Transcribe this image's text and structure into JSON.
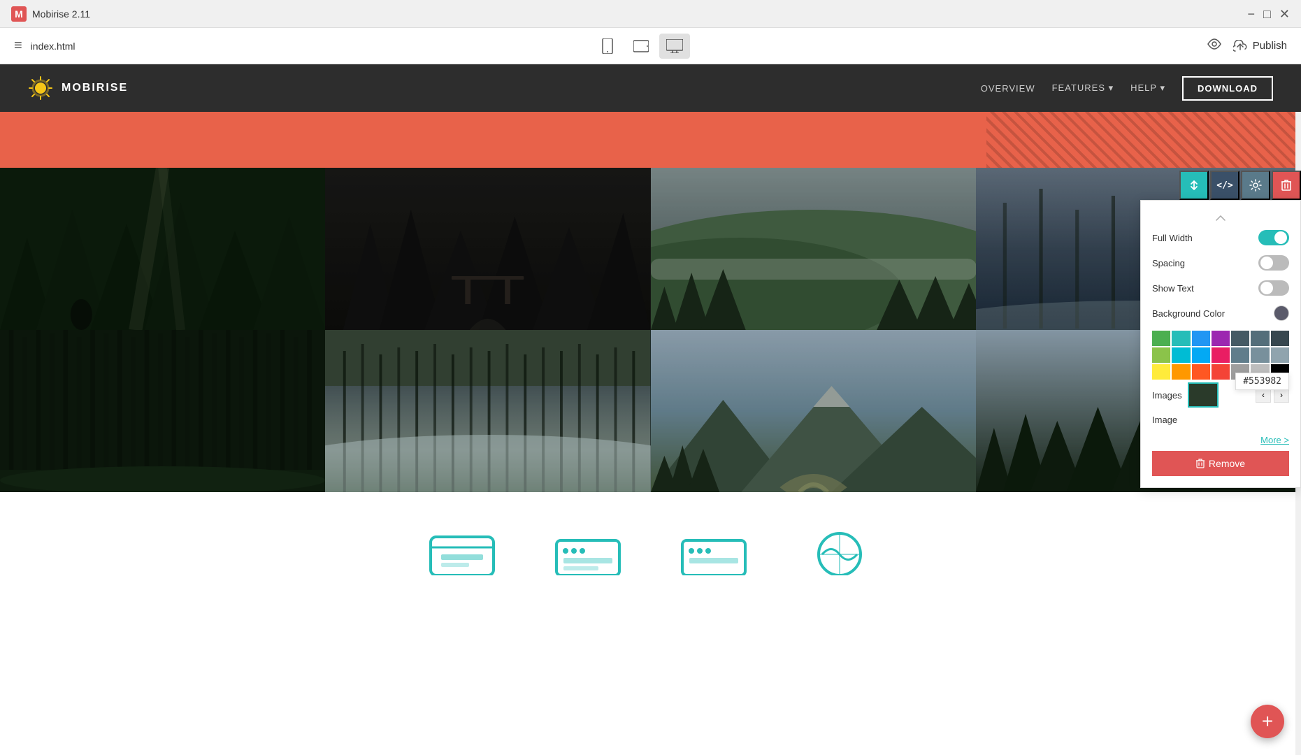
{
  "app": {
    "title": "Mobirise 2.11",
    "filename": "index.html"
  },
  "titlebar": {
    "controls": {
      "minimize": "−",
      "maximize": "□",
      "close": "✕"
    }
  },
  "toolbar": {
    "menu_icon": "≡",
    "devices": [
      {
        "id": "mobile",
        "label": "Mobile",
        "active": false
      },
      {
        "id": "tablet",
        "label": "Tablet",
        "active": false
      },
      {
        "id": "desktop",
        "label": "Desktop",
        "active": true
      }
    ],
    "preview_icon": "👁",
    "publish_label": "Publish",
    "publish_icon": "☁"
  },
  "site": {
    "brand": "MOBIRISE",
    "nav": [
      {
        "label": "OVERVIEW",
        "active": false
      },
      {
        "label": "FEATURES",
        "has_arrow": true,
        "active": false
      },
      {
        "label": "HELP",
        "has_arrow": true,
        "active": false
      }
    ],
    "download_btn": "DOWNLOAD"
  },
  "block_toolbar": {
    "buttons": [
      {
        "id": "swap",
        "icon": "⇅",
        "color": "teal"
      },
      {
        "id": "code",
        "icon": "</>",
        "color": "dark"
      },
      {
        "id": "settings",
        "icon": "⚙",
        "color": "gear"
      },
      {
        "id": "delete",
        "icon": "🗑",
        "color": "red"
      }
    ]
  },
  "settings_panel": {
    "full_width": {
      "label": "Full Width",
      "value": true
    },
    "spacing": {
      "label": "Spacing",
      "value": false
    },
    "show_text": {
      "label": "Show Text",
      "value": false
    },
    "background_color": {
      "label": "Background Color"
    },
    "images_label": "Images",
    "image_label": "Image",
    "more_link": "More >",
    "remove_btn": "Remove",
    "color_hex": "#553982",
    "palette": {
      "row1": [
        "#4caf50",
        "#26bdb8",
        "#2196f3",
        "#9c27b0",
        "#455a64",
        "#546e7a",
        "#37474f"
      ],
      "row2": [
        "#8bc34a",
        "#00bcd4",
        "#03a9f4",
        "#e91e63",
        "#607d8b",
        "#78909c",
        "#90a4ae"
      ],
      "row3": [
        "#ffeb3b",
        "#ff9800",
        "#ff5722",
        "#f44336",
        "#9e9e9e",
        "#bdbdbd",
        "#000000"
      ]
    }
  },
  "gallery": {
    "images": [
      {
        "id": 1,
        "class": "img-1"
      },
      {
        "id": 2,
        "class": "img-2"
      },
      {
        "id": 3,
        "class": "img-3"
      },
      {
        "id": 4,
        "class": "img-4"
      },
      {
        "id": 5,
        "class": "img-5"
      },
      {
        "id": 6,
        "class": "img-6"
      },
      {
        "id": 7,
        "class": "img-7"
      },
      {
        "id": 8,
        "class": "img-8"
      }
    ]
  },
  "fab": {
    "icon": "+"
  }
}
